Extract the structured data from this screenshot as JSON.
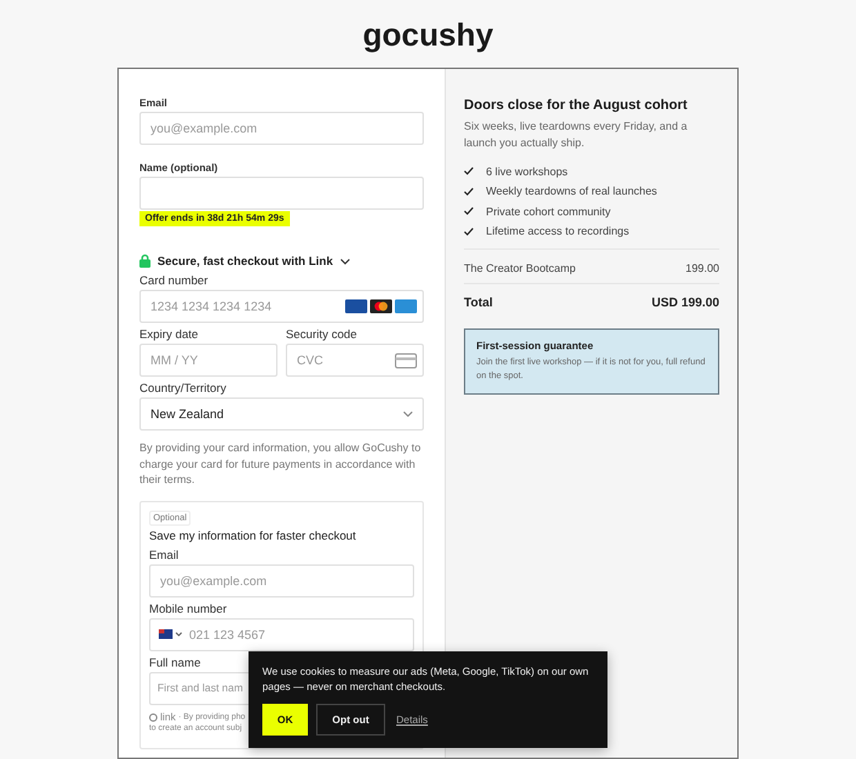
{
  "logo": "gocushy",
  "form": {
    "email": {
      "label": "Email",
      "placeholder": "you@example.com"
    },
    "name": {
      "label": "Name (optional)"
    },
    "offer": "Offer ends in 38d 21h 54m 29s",
    "link_toggle": "Secure, fast checkout with Link",
    "card": {
      "label": "Card number",
      "placeholder": "1234 1234 1234 1234"
    },
    "expiry": {
      "label": "Expiry date",
      "placeholder": "MM / YY"
    },
    "cvc": {
      "label": "Security code",
      "placeholder": "CVC"
    },
    "country": {
      "label": "Country/Territory",
      "value": "New Zealand"
    },
    "terms": "By providing your card information, you allow GoCushy to charge your card for future payments in accordance with their terms.",
    "save": {
      "tag": "Optional",
      "title": "Save my information for faster checkout",
      "email": {
        "label": "Email",
        "placeholder": "you@example.com"
      },
      "mobile": {
        "label": "Mobile number",
        "placeholder": "021 123 4567"
      },
      "full_name": {
        "label": "Full name",
        "placeholder": "First and last nam"
      },
      "link_logo": "link",
      "disclaimer": [
        "· By providing pho",
        "to create an account subj"
      ]
    }
  },
  "summary": {
    "title": "Doors close for the August cohort",
    "subtitle": "Six weeks, live teardowns every Friday, and a launch you actually ship.",
    "features": [
      "6 live workshops",
      "Weekly teardowns of real launches",
      "Private cohort community",
      "Lifetime access to recordings"
    ],
    "line_item": {
      "name": "The Creator Bootcamp",
      "price": "199.00"
    },
    "total": {
      "label": "Total",
      "amount": "USD 199.00"
    },
    "guarantee": {
      "title": "First-session guarantee",
      "text": "Join the first live workshop — if it is not for you, full refund on the spot."
    }
  },
  "cookie_banner": {
    "text": "We use cookies to measure our ads (Meta, Google, TikTok) on our own pages — never on merchant checkouts.",
    "buttons": [
      {
        "label": "OK",
        "kind": "primary"
      },
      {
        "label": "Opt out",
        "kind": "secondary"
      },
      {
        "label": "Details",
        "kind": "link"
      }
    ]
  }
}
